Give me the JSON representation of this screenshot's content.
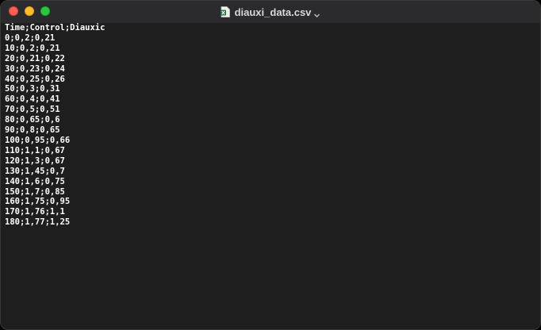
{
  "window": {
    "title": "diauxi_data.csv",
    "file_icon": "excel-csv-file-icon",
    "title_menu_icon": "chevron-down-icon"
  },
  "document": {
    "lines": [
      "Time;Control;Diauxic",
      "0;0,2;0,21",
      "10;0,2;0,21",
      "20;0,21;0,22",
      "30;0,23;0,24",
      "40;0,25;0,26",
      "50;0,3;0,31",
      "60;0,4;0,41",
      "70;0,5;0,51",
      "80;0,65;0,6",
      "90;0,8;0,65",
      "100;0,95;0,66",
      "110;1,1;0,67",
      "120;1,3;0,67",
      "130;1,45;0,7",
      "140;1,6;0,75",
      "150;1,7;0,85",
      "160;1,75;0,95",
      "170;1,76;1,1",
      "180;1,77;1,25"
    ]
  },
  "colors": {
    "close": "#ff5f57",
    "minimize": "#febc2e",
    "zoom": "#28c840",
    "background": "#1e1e1e",
    "text": "#ffffff"
  }
}
